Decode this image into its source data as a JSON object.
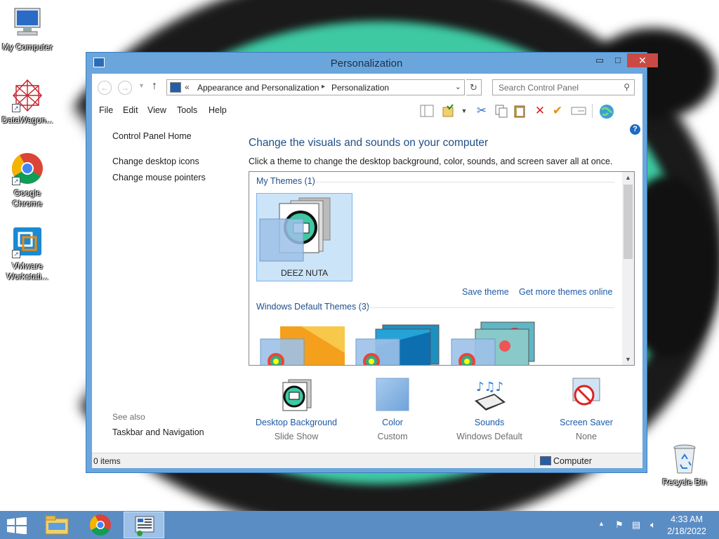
{
  "desktop": {
    "icons": [
      {
        "label": "My Computer"
      },
      {
        "label": "DataWagon..."
      },
      {
        "label": "Google Chrome"
      },
      {
        "label": "VMware Workstati..."
      },
      {
        "label": "Recycle Bin"
      }
    ]
  },
  "window": {
    "title": "Personalization",
    "min_glyph": "▭",
    "max_glyph": "□",
    "close_glyph": "✕"
  },
  "address": {
    "chevron": "«",
    "crumbs": [
      "Appearance and Personalization",
      "Personalization"
    ],
    "crumb_sep": "▸",
    "search_placeholder": "Search Control Panel"
  },
  "menu": [
    "File",
    "Edit",
    "View",
    "Tools",
    "Help"
  ],
  "left_nav": {
    "home": "Control Panel Home",
    "links": [
      "Change desktop icons",
      "Change mouse pointers"
    ],
    "see_also_label": "See also",
    "see_also_links": [
      "Taskbar and Navigation"
    ]
  },
  "main": {
    "heading": "Change the visuals and sounds on your computer",
    "subheading": "Click a theme to change the desktop background, color, sounds, and screen saver all at once.",
    "my_themes_title": "My Themes (1)",
    "selected_theme": "DEEZ NUTA",
    "save_theme": "Save theme",
    "get_more": "Get more themes online",
    "default_themes_title": "Windows Default Themes (3)"
  },
  "settings": [
    {
      "label": "Desktop Background",
      "value": "Slide Show"
    },
    {
      "label": "Color",
      "value": "Custom"
    },
    {
      "label": "Sounds",
      "value": "Windows Default"
    },
    {
      "label": "Screen Saver",
      "value": "None"
    }
  ],
  "status": {
    "items": "0 items",
    "location": "Computer"
  },
  "taskbar": {
    "time": "4:33 AM",
    "date": "2/18/2022"
  },
  "colors": {
    "window_frame": "#6aa6dc",
    "link": "#1c5aa6",
    "heading": "#1f4e87",
    "taskbar": "#5b8dc5",
    "close": "#c94a44",
    "selection": "#cce4f7"
  }
}
